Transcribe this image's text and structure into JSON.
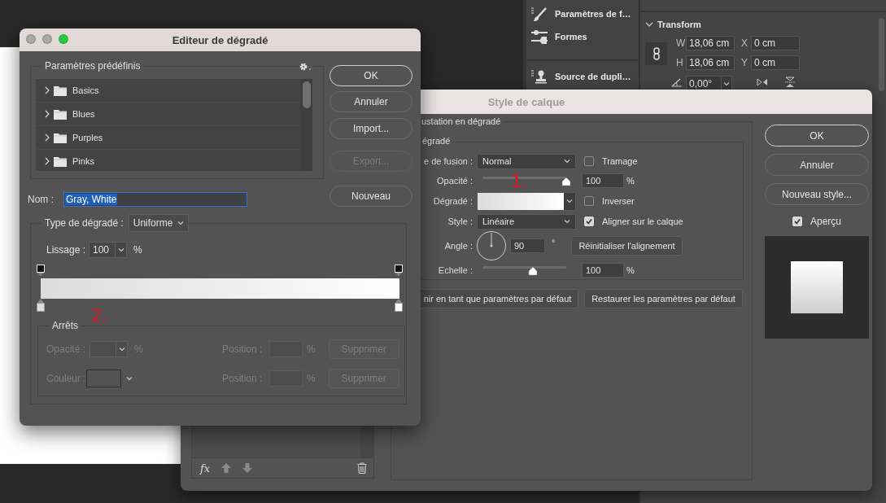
{
  "photoshop_panels": {
    "panel_items": [
      {
        "kind": "brush",
        "label": "Paramètres de f…"
      },
      {
        "kind": "shapes",
        "label": "Formes"
      },
      {
        "kind": "stamp",
        "label": "Source de dupli…"
      }
    ],
    "transform": {
      "title": "Transform",
      "expanded": true,
      "fields": [
        {
          "label": "W",
          "value": "18,06 cm"
        },
        {
          "label": "X",
          "value": "0 cm"
        },
        {
          "label": "H",
          "value": "18,06 cm"
        },
        {
          "label": "Y",
          "value": "0 cm"
        }
      ],
      "angle": "0,00°"
    }
  },
  "layer_style": {
    "title": "Style de calque",
    "active": false,
    "section_title": "ustation en dégradé",
    "subsection_title": "égradé",
    "rows": [
      {
        "kind": "select",
        "label": "e de fusion :",
        "value": "Normal",
        "checkbox": {
          "label": "Tramage",
          "checked": false
        }
      },
      {
        "kind": "slider",
        "label": "Opacité :",
        "level": 1.0,
        "value": "100",
        "unit": "%"
      },
      {
        "kind": "gradient",
        "label": "Dégradé :",
        "checkbox": {
          "label": "Inverser",
          "checked": false
        }
      },
      {
        "kind": "select",
        "label": "Style :",
        "value": "Linéaire",
        "checkbox": {
          "label": "Aligner sur le calque",
          "checked": true
        }
      },
      {
        "kind": "angle",
        "label": "Angle :",
        "value": "90",
        "unit": "°",
        "button": "Réinitialiser l'alignement"
      },
      {
        "kind": "slider",
        "label": "Echelle :",
        "level": 0.6,
        "value": "100",
        "unit": "%"
      }
    ],
    "default_buttons": [
      "nir en tant que paramètres par défaut",
      "Restaurer les paramètres par défaut"
    ],
    "side_buttons": [
      {
        "label": "OK",
        "default": true
      },
      {
        "label": "Annuler",
        "default": false
      },
      {
        "label": "Nouveau style...",
        "default": false
      }
    ],
    "preview": {
      "label": "Aperçu",
      "checked": true
    },
    "toolbar": {
      "fx": "fx"
    }
  },
  "gradient_editor": {
    "title": "Editeur de dégradé",
    "active": true,
    "window_buttons": [
      {
        "kind": "close",
        "enabled": false
      },
      {
        "kind": "minimize",
        "enabled": false
      },
      {
        "kind": "zoom",
        "enabled": true
      }
    ],
    "presets": {
      "title": "Paramètres prédéfinis",
      "folders": [
        {
          "label": "Basics",
          "expanded": false
        },
        {
          "label": "Blues",
          "expanded": false
        },
        {
          "label": "Purples",
          "expanded": false
        },
        {
          "label": "Pinks",
          "expanded": false
        }
      ]
    },
    "buttons": [
      {
        "label": "OK",
        "default": true,
        "disabled": false
      },
      {
        "label": "Annuler",
        "default": false,
        "disabled": false
      },
      {
        "label": "Import...",
        "default": false,
        "disabled": false
      },
      {
        "label": "Export...",
        "default": false,
        "disabled": true
      },
      {
        "label": "Nouveau",
        "default": false,
        "disabled": false
      }
    ],
    "name": {
      "label": "Nom :",
      "value": "Gray, White",
      "selected": true
    },
    "type": {
      "label": "Type de dégradé :",
      "value": "Uniforme"
    },
    "smoothness": {
      "label": "Lissage :",
      "value": "100",
      "unit": "%"
    },
    "stops": [
      {
        "color": "#dcdcdc"
      },
      {
        "color": "#ffffff"
      }
    ],
    "stops_panel": {
      "title": "Arrêts",
      "disabled": true,
      "rows": [
        {
          "kind": "opacity",
          "label": "Opacité :",
          "unit": "%",
          "position_label": "Position :",
          "position_unit": "%",
          "button": "Supprimer"
        },
        {
          "kind": "color",
          "label": "Couleur :",
          "position_label": "Position :",
          "position_unit": "%",
          "button": "Supprimer"
        }
      ]
    }
  },
  "annotations": [
    {
      "text": "1."
    },
    {
      "text": "2."
    }
  ]
}
